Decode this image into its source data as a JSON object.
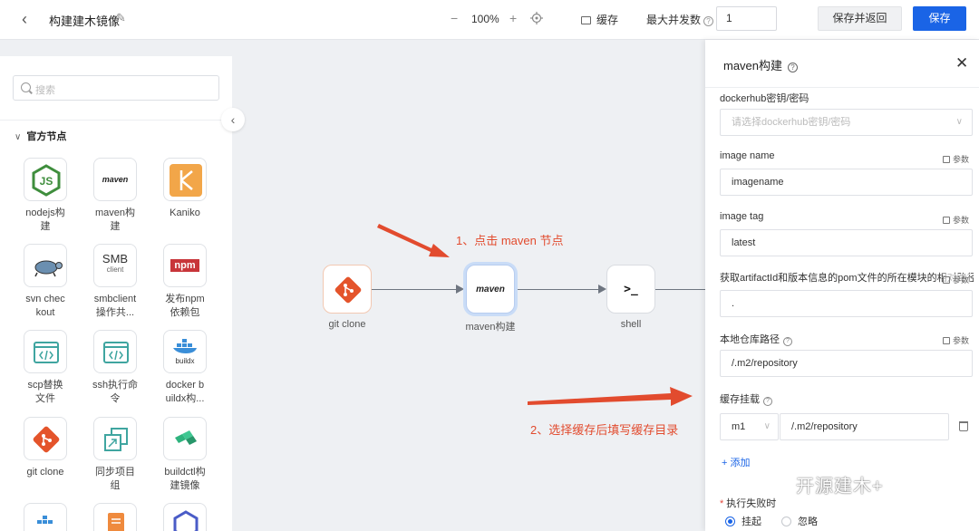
{
  "header": {
    "title": "构建建木镜像",
    "zoom_minus": "−",
    "zoom": "100%",
    "zoom_plus": "+",
    "cache_label": "缓存",
    "concurrency_label": "最大并发数",
    "concurrency_value": "1",
    "save_return_label": "保存并返回",
    "save_label": "保存"
  },
  "sidebar": {
    "search_placeholder": "搜索",
    "section_title": "官方节点",
    "items": [
      {
        "label": "nodejs构\n建",
        "icon": "nodejs-icon"
      },
      {
        "label": "maven构\n建",
        "icon": "maven-icon",
        "icon_text": "maven"
      },
      {
        "label": "Kaniko",
        "icon": "kaniko-icon"
      },
      {
        "label": "svn chec\nkout",
        "icon": "svn-turtle-icon"
      },
      {
        "label": "smbclient\n操作共...",
        "icon": "smb-icon",
        "icon_text": "SMB",
        "icon_sub": "client"
      },
      {
        "label": "发布npm\n依赖包",
        "icon": "npm-icon",
        "icon_text": "npm"
      },
      {
        "label": "scp替换\n文件",
        "icon": "code-window-icon"
      },
      {
        "label": "ssh执行命\n令",
        "icon": "code-window-icon"
      },
      {
        "label": "docker b\nuildx构...",
        "icon": "docker-buildx-icon",
        "icon_text": "buildx"
      },
      {
        "label": "git clone",
        "icon": "git-icon"
      },
      {
        "label": "同步项目\n组",
        "icon": "sync-icon"
      },
      {
        "label": "buildctl构\n建镜像",
        "icon": "buildkit-icon"
      }
    ]
  },
  "canvas": {
    "nodes": [
      {
        "label": "git clone",
        "icon": "git-icon"
      },
      {
        "label": "maven构建",
        "icon": "maven-icon",
        "icon_text": "maven"
      },
      {
        "label": "shell",
        "icon": "terminal-icon",
        "icon_text": ">_"
      }
    ],
    "annotation_1": "1、点击 maven 节点",
    "annotation_2": "2、选择缓存后填写缓存目录",
    "colors": {
      "annotation": "#e24b2e",
      "accent": "#1a64e6"
    }
  },
  "panel": {
    "title": "maven构建",
    "close": "✕",
    "param_label": "参数",
    "fields": {
      "dockerhub_label": "dockerhub密钥/密码",
      "dockerhub_placeholder": "请选择dockerhub密钥/密码",
      "image_name_label": "image name",
      "image_name_value": "imagename",
      "image_tag_label": "image tag",
      "image_tag_value": "latest",
      "pom_label": "获取artifactId和版本信息的pom文件的所在模块的相对路径",
      "pom_value": ".",
      "repo_label": "本地仓库路径",
      "repo_value": "/.m2/repository",
      "cache_mount_label": "缓存挂载",
      "cache_name": "m1",
      "cache_path": "/.m2/repository",
      "add_label": "+ 添加",
      "on_fail_label": "执行失败时",
      "option_suspend": "挂起",
      "option_ignore": "忽略"
    }
  },
  "watermark": "开源建木+"
}
